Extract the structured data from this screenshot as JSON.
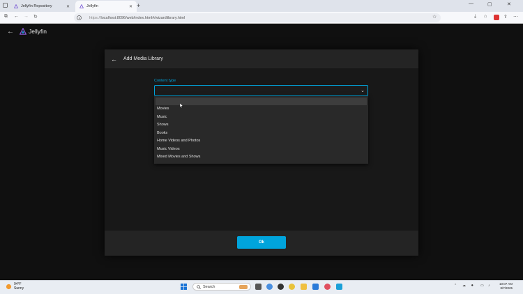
{
  "browser": {
    "tabs": [
      {
        "label": "Jellyfin Repository"
      },
      {
        "label": "Jellyfin"
      }
    ],
    "url_prefix": "https://",
    "url_main": "localhost:8096/web/index.html#/wizardlibrary.html",
    "new_tab_glyph": "+",
    "window_controls": [
      "—",
      "▢",
      "✕"
    ]
  },
  "app": {
    "brand": "Jellyfin",
    "accent_color": "#00a4dc"
  },
  "dialog": {
    "title": "Add Media Library",
    "content_type_label": "Content type",
    "content_type_value": "",
    "options": [
      "Movies",
      "Music",
      "Shows",
      "Books",
      "Home Videos and Photos",
      "Music Videos",
      "Mixed Movies and Shows"
    ],
    "ok_label": "Ok"
  },
  "taskbar": {
    "weather_temp": "94°F",
    "weather_desc": "Sunny",
    "search_placeholder": "Search",
    "time": "10:07 AM",
    "date": "8/7/2025"
  },
  "icons": [
    "back-arrow-icon",
    "jellyfin-logo-icon",
    "chevron-down-icon",
    "windows-start-icon",
    "search-icon",
    "mouse-cursor-icon"
  ]
}
